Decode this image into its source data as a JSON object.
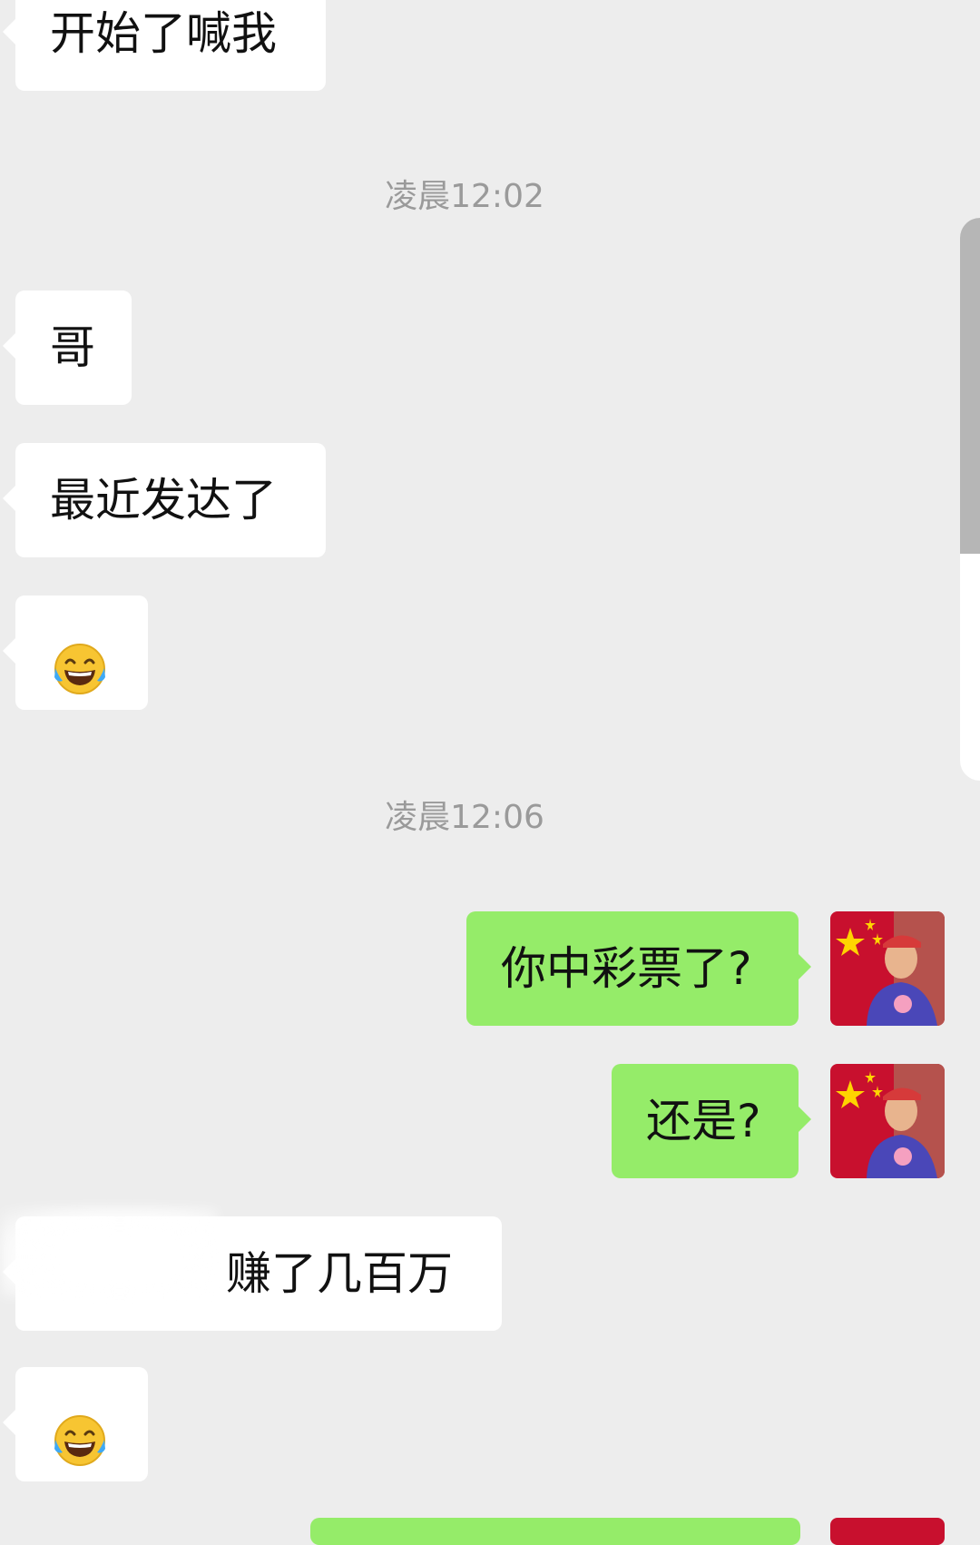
{
  "messages": [
    {
      "side": "left",
      "text": "开始了喊我"
    },
    {
      "timestamp": "凌晨12:02"
    },
    {
      "side": "left",
      "text": "哥"
    },
    {
      "side": "left",
      "text": "最近发达了"
    },
    {
      "side": "left",
      "emoji": "laughing-tears"
    },
    {
      "timestamp": "凌晨12:06"
    },
    {
      "side": "right",
      "text": "你中彩票了?"
    },
    {
      "side": "right",
      "text": "还是?"
    },
    {
      "side": "left",
      "text": "赚了几百万"
    },
    {
      "side": "left",
      "emoji": "laughing-tears"
    }
  ],
  "colors": {
    "background": "#ededed",
    "left_bubble": "#ffffff",
    "right_bubble": "#95ec69",
    "timestamp_text": "#9a9a9a"
  }
}
